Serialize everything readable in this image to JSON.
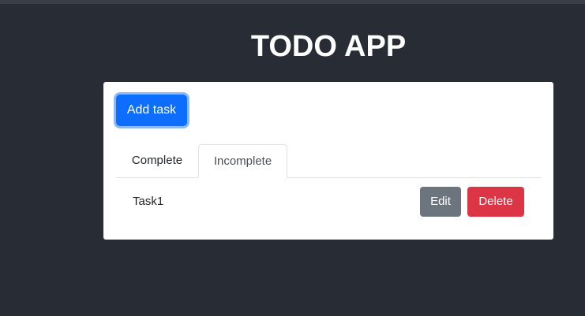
{
  "app": {
    "title": "TODO APP"
  },
  "toolbar": {
    "add_task_label": "Add task"
  },
  "tabs": [
    {
      "label": "Complete",
      "active": false
    },
    {
      "label": "Incomplete",
      "active": true
    }
  ],
  "tasks": [
    {
      "name": "Task1",
      "edit_label": "Edit",
      "delete_label": "Delete"
    }
  ],
  "colors": {
    "background": "#282c34",
    "primary": "#0d6efd",
    "secondary": "#6c757d",
    "danger": "#dc3545"
  }
}
